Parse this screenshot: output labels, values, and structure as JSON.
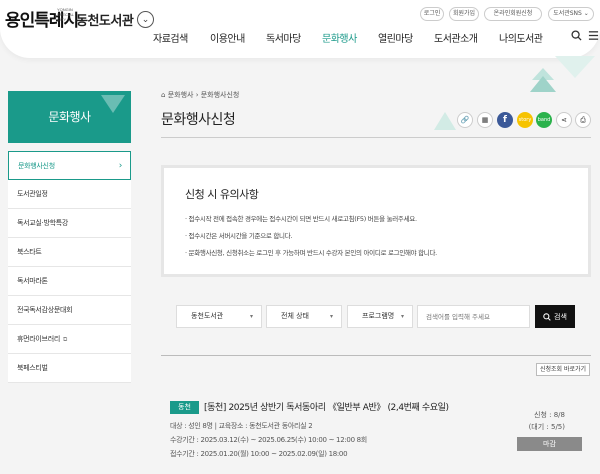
{
  "header": {
    "logo_text": "용인특례시",
    "logo_sub": "YONGIN SPECIAL CITY",
    "library_name": "동천도서관",
    "util_links": [
      "로그인",
      "회원가입",
      "온라인회원신청",
      "도서관SNS"
    ],
    "nav": [
      "자료검색",
      "이용안내",
      "독서마당",
      "문화행사",
      "열린마당",
      "도서관소개",
      "나의도서관"
    ],
    "active_nav": "문화행사"
  },
  "sidebar": {
    "title": "문화행사",
    "items": [
      {
        "label": "문화행사신청",
        "active": true
      },
      {
        "label": "도서관일정",
        "active": false
      },
      {
        "label": "독서교실·방학특강",
        "active": false
      },
      {
        "label": "북스타트",
        "active": false
      },
      {
        "label": "독서마라톤",
        "active": false
      },
      {
        "label": "전국독서감상문대회",
        "active": false
      },
      {
        "label": "휴먼라이브러리",
        "active": false,
        "external": true
      },
      {
        "label": "북페스티벌",
        "active": false
      }
    ]
  },
  "breadcrumb": {
    "home_icon": "home-icon",
    "items": [
      "문화행사",
      "문화행사신청"
    ]
  },
  "page_title": "문화행사신청",
  "share_icons": [
    "link-icon",
    "qrcode-icon",
    "facebook-icon",
    "kakaostory-icon",
    "band-icon",
    "share-icon",
    "print-icon"
  ],
  "notice": {
    "title": "신청 시 유의사항",
    "items": [
      "· 접수시작 전에 접속한 경우에는 접수시간이 되면 반드시 새로고침(F5) 버튼을 눌러주세요.",
      "· 접수시간은 서버시간을 기준으로 합니다.",
      "· 문화행사신청, 신청취소는 로그인 후 가능하며 반드시 수강자 본인의 아이디로 로그인해야 합니다."
    ]
  },
  "filters": {
    "library": "동천도서관",
    "status": "전체 상태",
    "field": "프로그램명",
    "search_placeholder": "검색어를 입력해 주세요",
    "search_button": "검색"
  },
  "shortcut_label": "신청조회 바로가기",
  "program": {
    "badge": "동천",
    "title": "[동천] 2025년 상반기 독서동아리 《일반부 A반》 (2,4번째 수요일)",
    "target": "대상 : 성인 8명",
    "place": "교육장소 : 동천도서관 동아리실 2",
    "period": "수강기간 : 2025.03.12(수) ~ 2025.06.25(수) 10:00 ~ 12:00 8회",
    "apply_period": "접수기간 : 2025.01.20(월) 10:00 ~ 2025.02.09(일) 18:00",
    "seats": "신청 : 8/8",
    "waiting": "(대기 : 5/5)",
    "status": "마감"
  },
  "colors": {
    "accent": "#1a9a8a",
    "closed": "#8a8a8a",
    "facebook": "#3b5998",
    "kakaostory": "#f6c300",
    "band": "#2bb24c"
  }
}
